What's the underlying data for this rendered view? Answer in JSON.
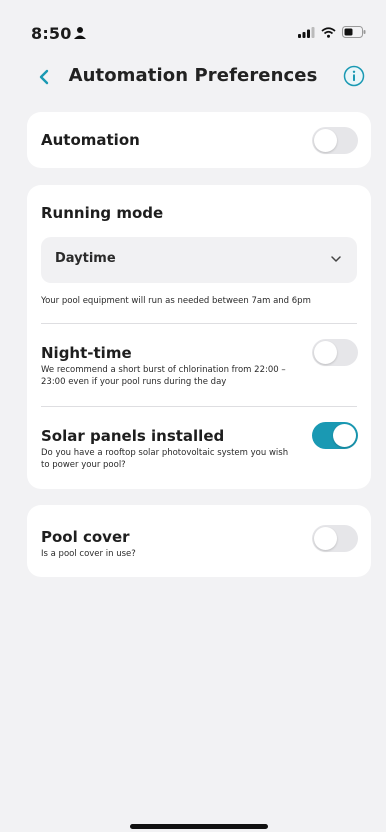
{
  "status_bar": {
    "time": "8:50"
  },
  "header": {
    "title": "Automation Preferences"
  },
  "automation": {
    "label": "Automation",
    "enabled": false
  },
  "running_mode": {
    "label": "Running mode",
    "selected": "Daytime",
    "description": "Your pool equipment will run as needed between 7am and 6pm",
    "night_time": {
      "label": "Night-time",
      "description": "We recommend a short burst of chlorination from 22:00 – 23:00 even if your pool runs during the day",
      "enabled": false
    },
    "solar": {
      "label": "Solar panels installed",
      "description": "Do you have a rooftop solar photovoltaic system you wish to power your pool?",
      "enabled": true
    }
  },
  "pool_cover": {
    "label": "Pool cover",
    "description": "Is a pool cover in use?",
    "enabled": false
  },
  "colors": {
    "accent": "#1a99b3",
    "background": "#f2f2f4",
    "card": "#ffffff"
  }
}
